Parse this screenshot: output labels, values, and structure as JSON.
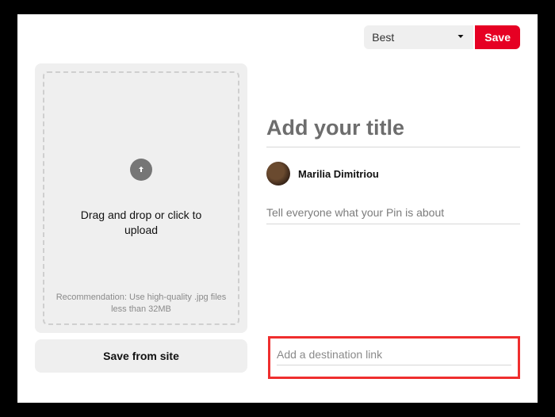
{
  "header": {
    "board_selected": "Best",
    "save_label": "Save"
  },
  "upload": {
    "primary_text": "Drag and drop or click to upload",
    "hint": "Recommendation: Use high-quality .jpg files less than 32MB",
    "site_button_label": "Save from site"
  },
  "form": {
    "title_placeholder": "Add your title",
    "title_value": "",
    "user_name": "Marilia Dimitriou",
    "desc_placeholder": "Tell everyone what your Pin is about",
    "desc_value": "",
    "link_placeholder": "Add a destination link",
    "link_value": ""
  },
  "colors": {
    "accent": "#e60023",
    "highlight_border": "#ef2e2e"
  }
}
